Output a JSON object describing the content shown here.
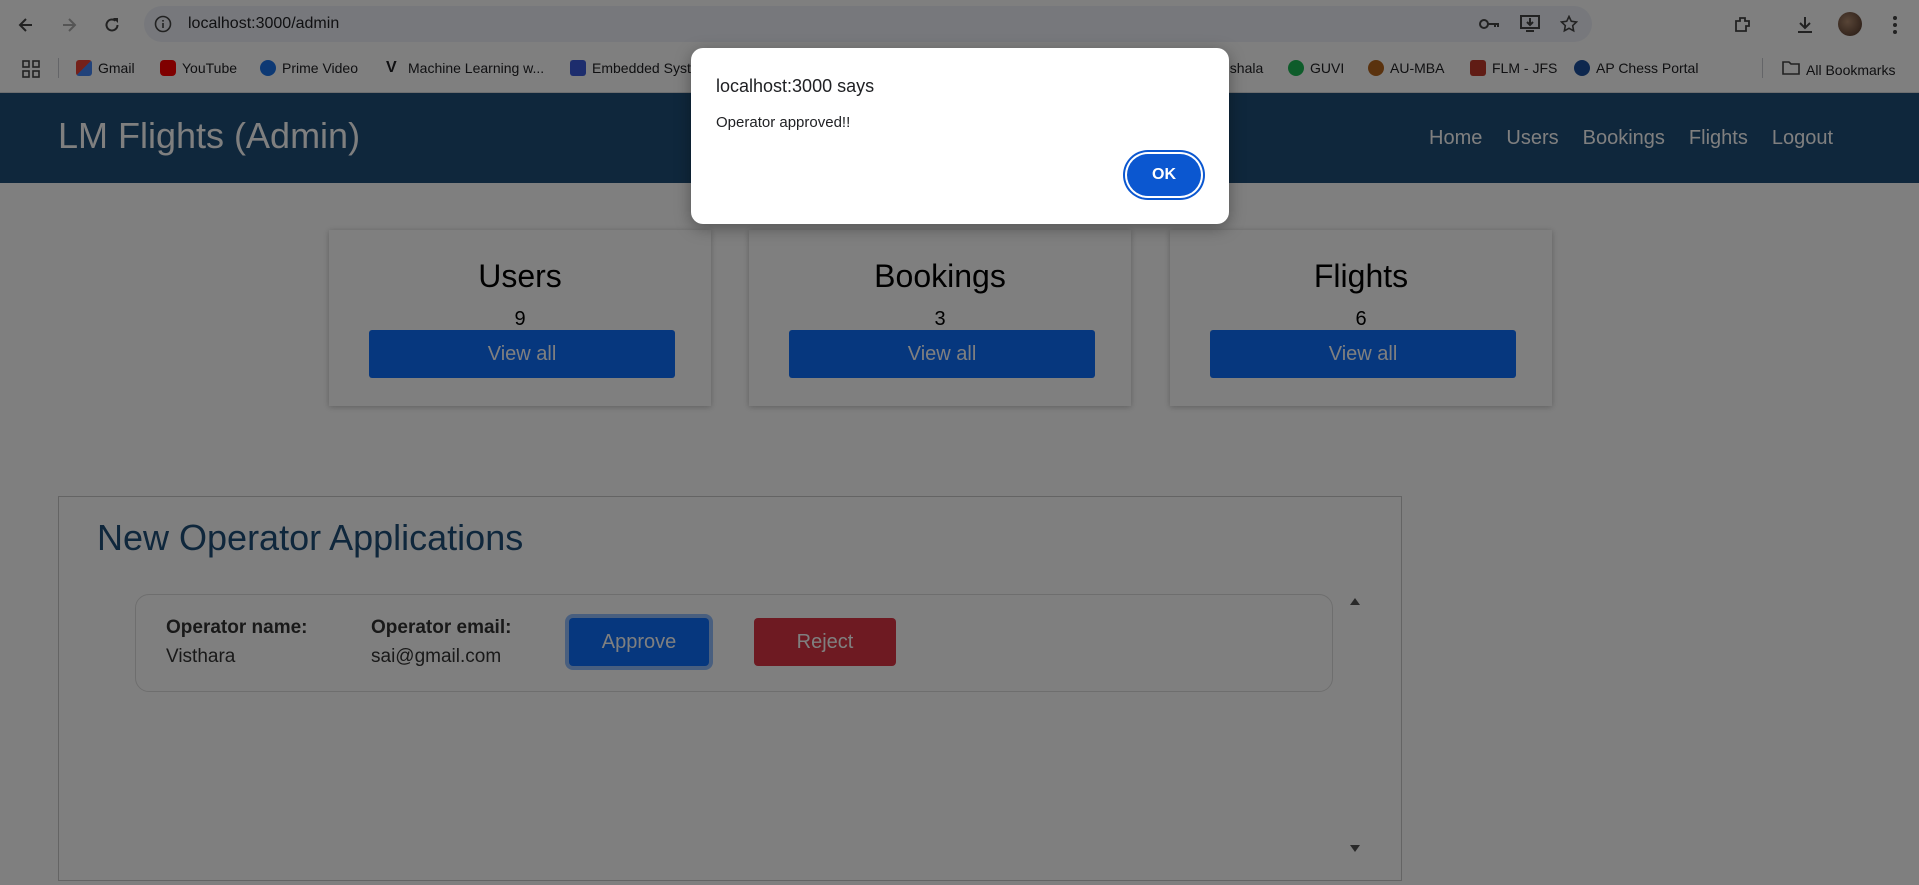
{
  "browser": {
    "url": "localhost:3000/admin",
    "bookmarks": [
      {
        "label": "Gmail",
        "color": "#ea4335"
      },
      {
        "label": "YouTube",
        "color": "#ff0000"
      },
      {
        "label": "Prime Video",
        "color": "#1a73e8"
      },
      {
        "label": "Machine Learning w...",
        "color": "#202124"
      },
      {
        "label": "Embedded Syst",
        "color": "#3b5bdb"
      },
      {
        "label": "nshala",
        "color": "#ffffff"
      },
      {
        "label": "GUVI",
        "color": "#1db954"
      },
      {
        "label": "AU-MBA",
        "color": "#b5651d"
      },
      {
        "label": "FLM - JFS",
        "color": "#c0392b"
      },
      {
        "label": "AP Chess Portal",
        "color": "#1a4f9c"
      }
    ],
    "all_bookmarks": "All Bookmarks"
  },
  "navbar": {
    "brand": "LM Flights (Admin)",
    "menu": [
      "Home",
      "Users",
      "Bookings",
      "Flights",
      "Logout"
    ]
  },
  "stats": [
    {
      "title": "Users",
      "count": "9",
      "button": "View all"
    },
    {
      "title": "Bookings",
      "count": "3",
      "button": "View all"
    },
    {
      "title": "Flights",
      "count": "6",
      "button": "View all"
    }
  ],
  "applications": {
    "heading": "New Operator Applications",
    "items": [
      {
        "name_label": "Operator name:",
        "name": "Visthara",
        "email_label": "Operator email:",
        "email": "sai@gmail.com",
        "approve": "Approve",
        "reject": "Reject"
      }
    ]
  },
  "dialog": {
    "title": "localhost:3000 says",
    "message": "Operator approved!!",
    "ok": "OK"
  },
  "colors": {
    "navbar": "#1f4e79",
    "primary": "#0d6efd",
    "danger": "#dc3545",
    "dialog_button": "#0b57d0"
  }
}
